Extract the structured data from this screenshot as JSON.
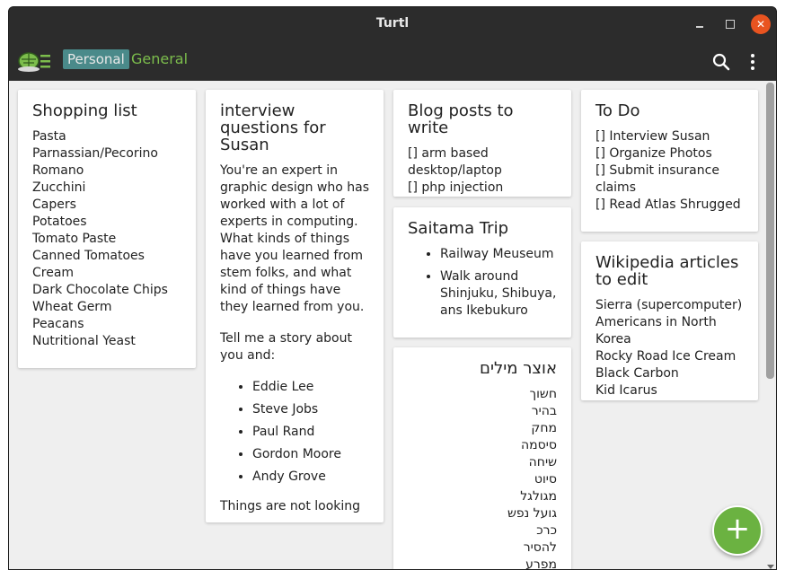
{
  "window": {
    "title": "Turtl"
  },
  "appbar": {
    "spaces": [
      "Personal",
      "General"
    ],
    "icons": {
      "logo": "turtle-logo-icon",
      "search": "search-icon",
      "menu": "more-vert-icon"
    }
  },
  "notes": [
    {
      "title": "Shopping list",
      "lines": [
        "Pasta",
        "Parnassian/Pecorino",
        "Romano",
        "Zucchini",
        "Capers",
        "Potatoes",
        "Tomato Paste",
        "Canned Tomatoes",
        "Cream",
        "Dark Chocolate Chips",
        "Wheat Germ",
        "Peacans",
        "Nutritional Yeast"
      ]
    },
    {
      "title": "interview questions for Susan",
      "p1": "You're an expert in graphic design who has worked with a lot of experts in computing. What kinds of things have you learned from stem folks, and what kind of things have they learned from you.",
      "p2": "Tell me a story about you and:",
      "items": [
        "Eddie Lee",
        "Steve Jobs",
        "Paul Rand",
        "Gordon Moore",
        "Andy Grove"
      ],
      "p3": "Things are not looking"
    },
    {
      "title": "Blog posts to write",
      "lines": [
        "[] arm based desktop/laptop",
        "[] php injection"
      ]
    },
    {
      "title": "Saitama Trip",
      "items": [
        "Railway Meuseum",
        "Walk around Shinjuku, Shibuya, ans Ikebukuro"
      ]
    },
    {
      "title": "אוצר מילים",
      "lines": [
        "חשוך",
        "בהיר",
        "מחק",
        "סיסמה",
        "שיחה",
        "סיוט",
        "מגולגל",
        "גועל נפש",
        "כרכ",
        "להסיר",
        "מפרע"
      ]
    },
    {
      "title": "To Do",
      "lines": [
        "[] Interview Susan",
        "[] Organize Photos",
        "[] Submit insurance claims",
        "[] Read Atlas Shrugged"
      ]
    },
    {
      "title": "Wikipedia articles to edit",
      "lines": [
        "Sierra (supercomputer)",
        "Americans in North Korea",
        "Rocky Road Ice Cream",
        "Black Carbon",
        "Kid Icarus"
      ]
    }
  ],
  "fab": {
    "label": "+"
  }
}
